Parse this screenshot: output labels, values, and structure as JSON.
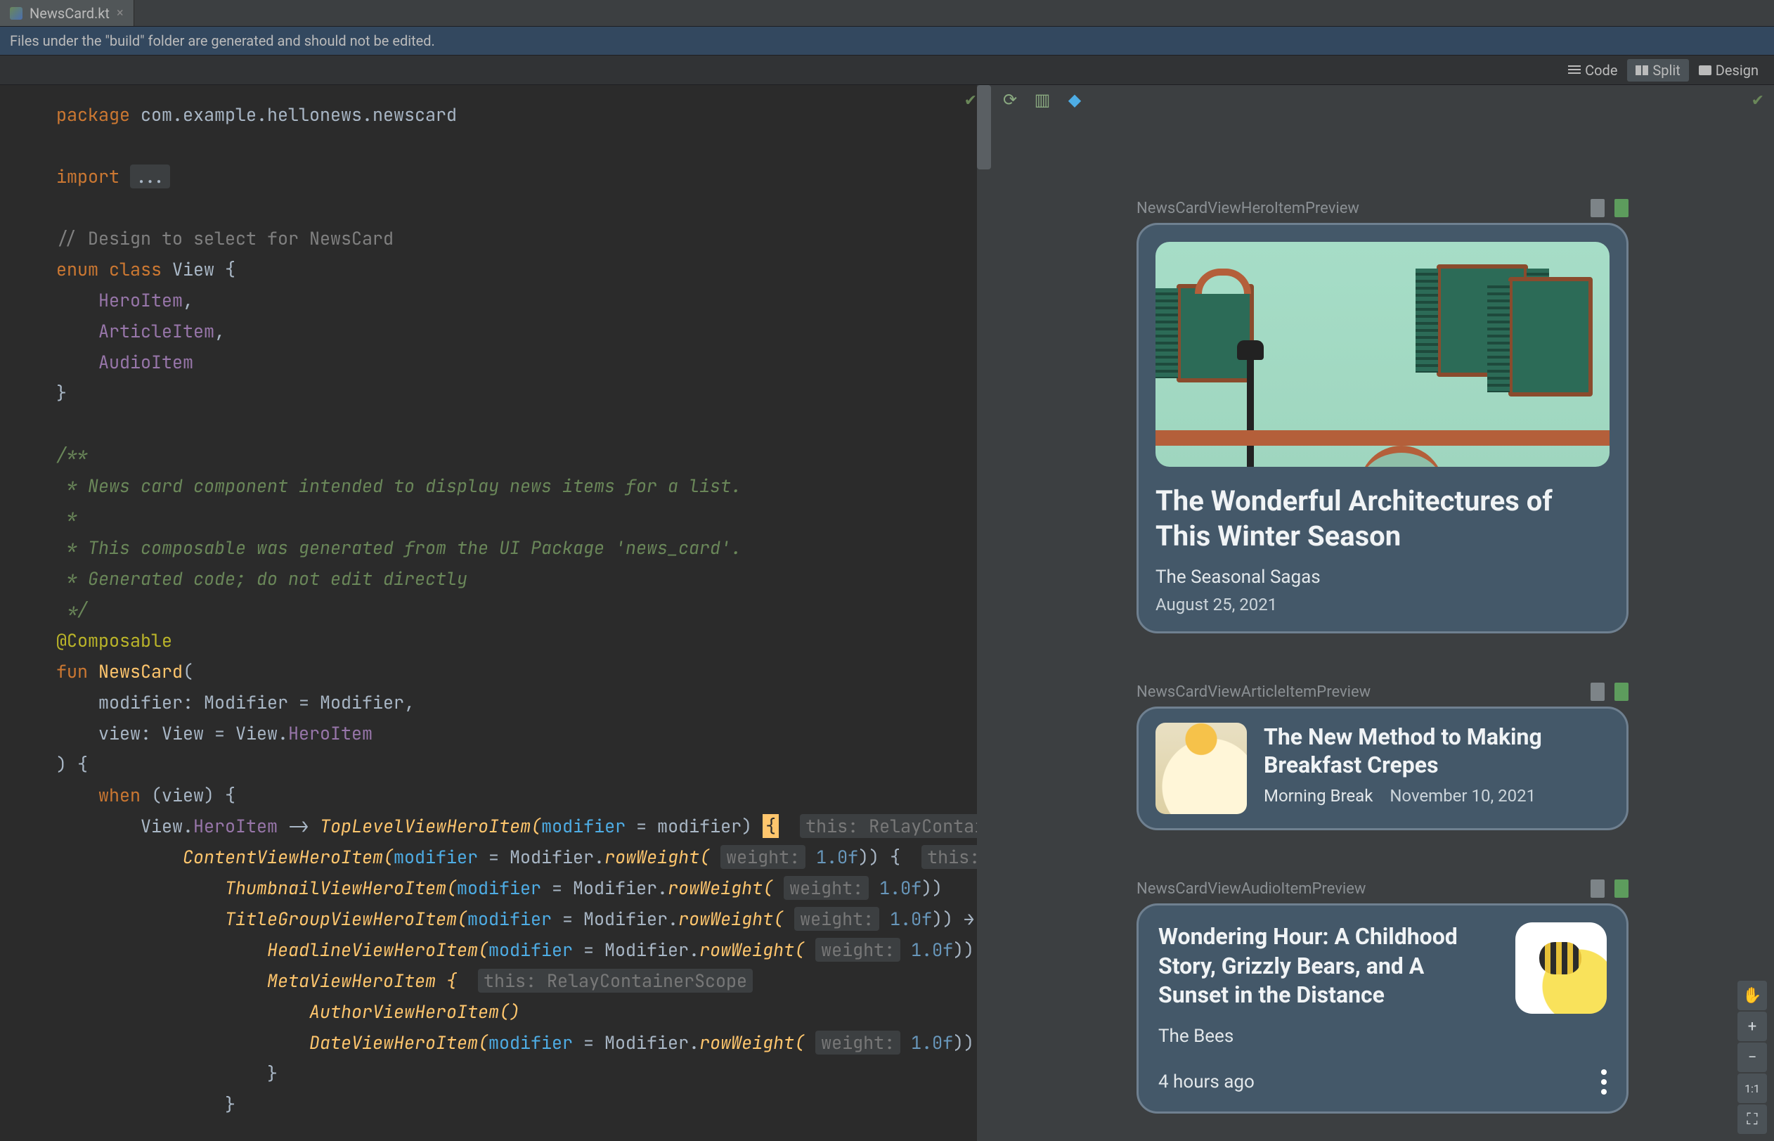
{
  "tab": {
    "filename": "NewsCard.kt"
  },
  "warning": "Files under the \"build\" folder are generated and should not be edited.",
  "viewToggle": {
    "code": "Code",
    "split": "Split",
    "design": "Design"
  },
  "code": {
    "package_kw": "package",
    "package_name": "com.example.hellonews.newscard",
    "import_kw": "import",
    "import_rest": "...",
    "comment_design": "// Design to select for NewsCard",
    "enum_kw": "enum class",
    "enum_name": "View",
    "enum_items": [
      "HeroItem",
      "ArticleItem",
      "AudioItem"
    ],
    "doc1": "/**",
    "doc2": " * News card component intended to display news items for a list.",
    "doc3": " *",
    "doc4": " * This composable was generated from the UI Package 'news_card'.",
    "doc5": " * Generated code; do not edit directly",
    "doc6": " */",
    "anno": "@Composable",
    "fun_kw": "fun",
    "fun_name": "NewsCard",
    "p_modifier": "modifier: Modifier = Modifier,",
    "p_view_a": "view: View = View.",
    "p_view_b": "HeroItem",
    "when_kw": "when",
    "when_cond": "(view) {",
    "hero_branch_a": "View.",
    "hero_branch_b": "HeroItem",
    "hero_branch_c": " -> ",
    "hero_branch_d": "TopLevelViewHeroItem(",
    "hero_branch_e": "modifier",
    "hero_branch_f": " = modifier) ",
    "hint_relay": "this: RelayContain",
    "content_a": "ContentViewHeroItem(",
    "content_b": "modifier",
    "content_c": " = Modifier.",
    "content_d": "rowWeight(",
    "content_e": "weight:",
    "content_f": "1.0f",
    "content_g": ")) {",
    "hint_r": "this: R",
    "thumb": "ThumbnailViewHeroItem(",
    "rw": "rowWeight(",
    "one": "1.0f",
    "titlegrp": "TitleGroupViewHeroItem(",
    "headline": "HeadlineViewHeroItem(",
    "metav": "MetaViewHeroItem {",
    "hint_scope": "this: RelayContainerScope",
    "author": "AuthorViewHeroItem()",
    "datev": "DateViewHeroItem("
  },
  "previews": {
    "hero": {
      "label": "NewsCardViewHeroItemPreview",
      "title": "The Wonderful Architectures of This Winter Season",
      "subtitle": "The Seasonal Sagas",
      "date": "August 25, 2021"
    },
    "article": {
      "label": "NewsCardViewArticleItemPreview",
      "title": "The New Method to Making Breakfast Crepes",
      "source": "Morning Break",
      "date": "November 10, 2021"
    },
    "audio": {
      "label": "NewsCardViewAudioItemPreview",
      "title": "Wondering Hour: A Childhood Story, Grizzly Bears, and A Sunset in the Distance",
      "subtitle": "The Bees",
      "time": "4 hours ago"
    }
  },
  "zoom": {
    "ratio": "1:1"
  }
}
